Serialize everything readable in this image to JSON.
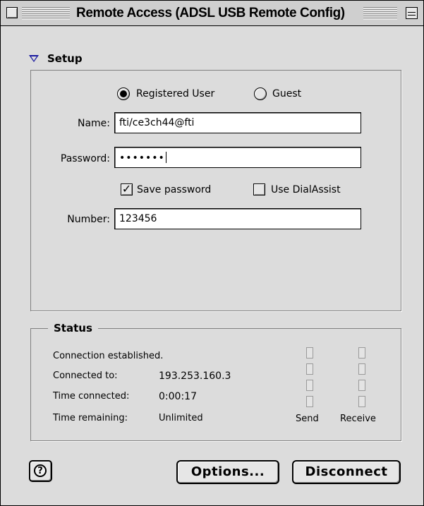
{
  "window": {
    "title": "Remote Access (ADSL USB Remote Config)"
  },
  "setup": {
    "label": "Setup",
    "user_type": {
      "registered_label": "Registered User",
      "guest_label": "Guest",
      "selected": "Registered User"
    },
    "name_label": "Name:",
    "name_value": "fti/ce3ch44@fti",
    "password_label": "Password:",
    "password_value": "•••••••",
    "save_password_label": "Save password",
    "save_password_checked": true,
    "use_dialassist_label": "Use DialAssist",
    "use_dialassist_checked": false,
    "number_label": "Number:",
    "number_value": "123456"
  },
  "status": {
    "label": "Status",
    "message": "Connection established.",
    "connected_to_label": "Connected to:",
    "connected_to_value": "193.253.160.3",
    "time_connected_label": "Time connected:",
    "time_connected_value": "0:00:17",
    "time_remaining_label": "Time remaining:",
    "time_remaining_value": "Unlimited",
    "send_label": "Send",
    "receive_label": "Receive"
  },
  "buttons": {
    "options": "Options...",
    "disconnect": "Disconnect"
  },
  "icons": {
    "help": "help-icon",
    "close": "close-box-icon",
    "zoom": "zoom-box-icon",
    "disclosure": "disclosure-triangle-icon"
  }
}
